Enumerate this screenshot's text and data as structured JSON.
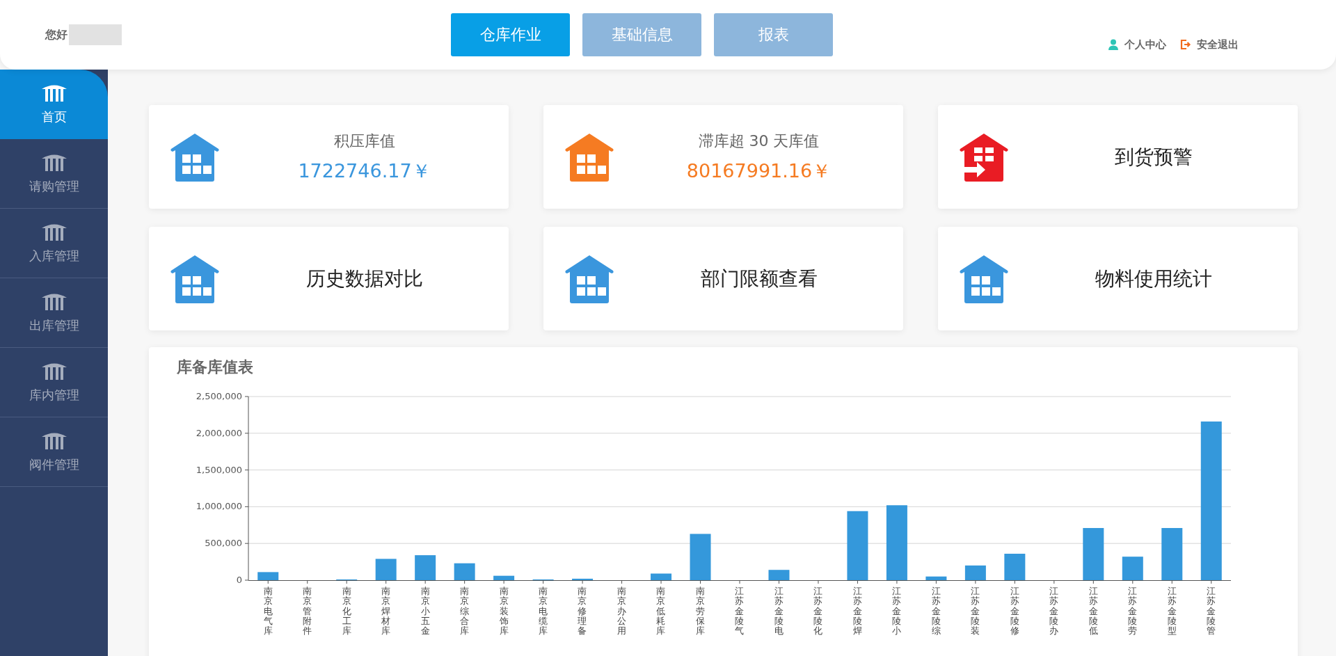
{
  "header": {
    "greeting": "您好",
    "nav": [
      {
        "label": "仓库作业",
        "selected": true
      },
      {
        "label": "基础信息",
        "selected": false
      },
      {
        "label": "报表",
        "selected": false
      }
    ],
    "user_links": [
      {
        "kind": "profile",
        "label": "个人中心"
      },
      {
        "kind": "logout",
        "label": "安全退出"
      }
    ]
  },
  "sidebar": {
    "items": [
      {
        "label": "首页",
        "selected": true
      },
      {
        "label": "请购管理",
        "selected": false
      },
      {
        "label": "入库管理",
        "selected": false
      },
      {
        "label": "出库管理",
        "selected": false
      },
      {
        "label": "库内管理",
        "selected": false
      },
      {
        "label": "阀件管理",
        "selected": false
      }
    ]
  },
  "cards": [
    {
      "kind": "stat",
      "title": "积压库值",
      "value": "1722746.17￥",
      "color": "#3a96dd"
    },
    {
      "kind": "stat",
      "title": "滞库超 30 天库值",
      "value": "80167991.16￥",
      "color": "#f57b22"
    },
    {
      "kind": "alert",
      "title": "到货预警",
      "color": "#e91c24"
    },
    {
      "kind": "link",
      "title": "历史数据对比",
      "color": "#3a96dd"
    },
    {
      "kind": "link",
      "title": "部门限额查看",
      "color": "#3a96dd"
    },
    {
      "kind": "link",
      "title": "物料使用统计",
      "color": "#3a96dd"
    }
  ],
  "chart_panel": {
    "title": "库备库值表",
    "chart_data": {
      "type": "bar",
      "categories": [
        "南京电气库",
        "南京管附件",
        "南京化工库",
        "南京焊材库",
        "南京小五金",
        "南京综合库",
        "南京装饰库",
        "南京电缆库",
        "南京修理备",
        "南京办公用",
        "南京低耗库",
        "南京劳保库",
        "江苏金陵气",
        "江苏金陵电",
        "江苏金陵化",
        "江苏金陵焊",
        "江苏金陵小",
        "江苏金陵综",
        "江苏金陵装",
        "江苏金陵修",
        "江苏金陵办",
        "江苏金陵低",
        "江苏金陵劳",
        "江苏金陵型",
        "江苏金陵管"
      ],
      "series": [
        {
          "color": "#3498db",
          "values": [
            110000,
            0,
            10000,
            290000,
            340000,
            230000,
            60000,
            10000,
            20000,
            0,
            90000,
            630000,
            0,
            140000,
            0,
            940000,
            1020000,
            50000,
            200000,
            360000,
            0,
            710000,
            320000,
            710000,
            2160000
          ]
        }
      ],
      "grid": true,
      "ylim": [
        0,
        2500000
      ],
      "yticks": [
        {
          "value": 0,
          "label": "0"
        },
        {
          "value": 500000,
          "label": "500,000"
        },
        {
          "value": 1000000,
          "label": "1,000,000"
        },
        {
          "value": 1500000,
          "label": "1,500,000"
        },
        {
          "value": 2000000,
          "label": "2,000,000"
        },
        {
          "value": 2500000,
          "label": "2,500,000"
        }
      ]
    }
  }
}
